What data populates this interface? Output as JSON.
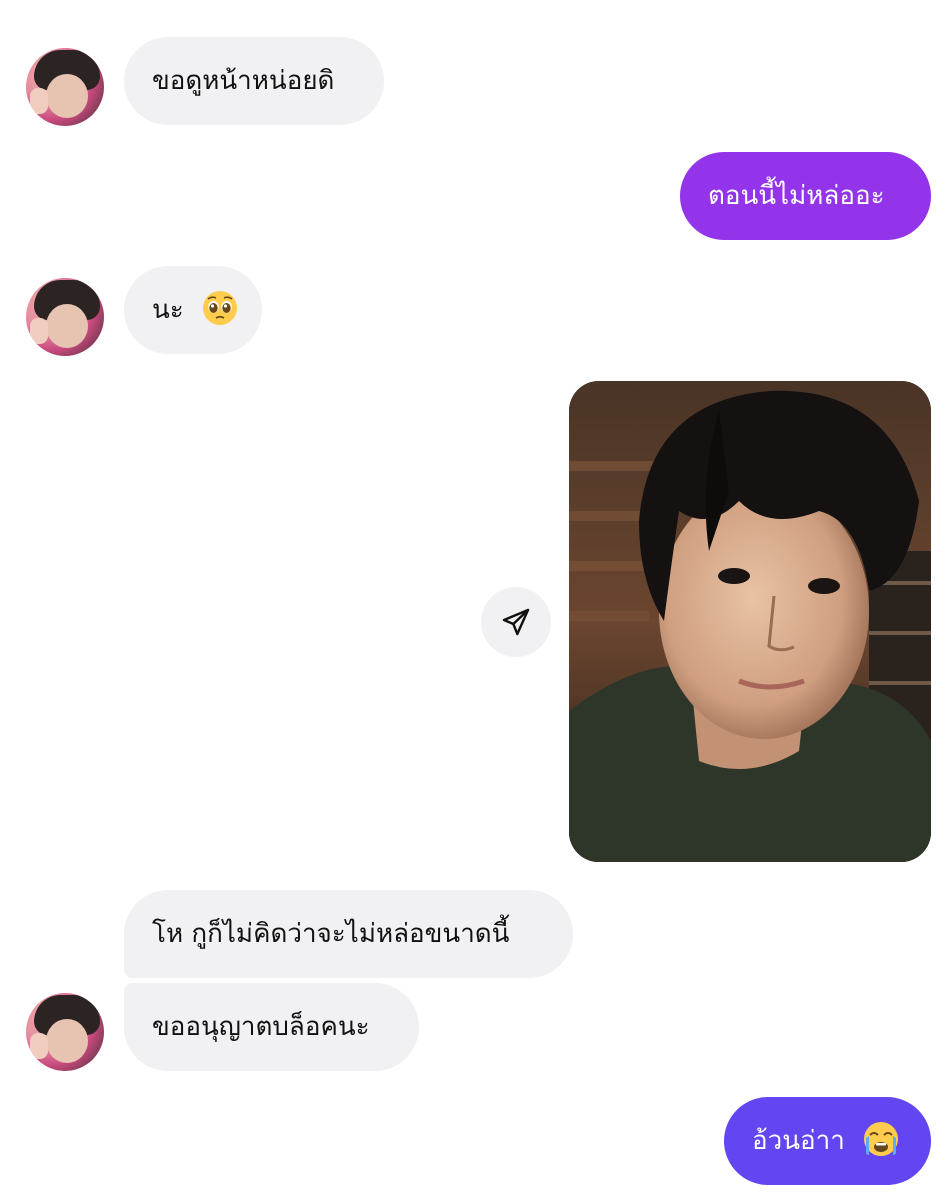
{
  "messages": [
    {
      "id": "m1",
      "direction": "received",
      "text": "ขอดูหน้าหน่อยดิ",
      "show_avatar": true
    },
    {
      "id": "m2",
      "direction": "sent",
      "text": "ตอนนี้ไม่หล่ออะ",
      "color": "#9333ea"
    },
    {
      "id": "m3",
      "direction": "received",
      "text": "นะ",
      "emoji": "pleading-face",
      "show_avatar": true
    },
    {
      "id": "m4",
      "direction": "sent",
      "type": "photo",
      "description": "selfie-photo"
    },
    {
      "id": "m5",
      "direction": "received",
      "text": "โห กูก็ไม่คิดว่าจะไม่หล่อขนาดนี้",
      "show_avatar": false
    },
    {
      "id": "m6",
      "direction": "received",
      "text": "ขออนุญาตบล็อคนะ",
      "show_avatar": true
    },
    {
      "id": "m7",
      "direction": "sent",
      "text": "อ้วนอ่าา",
      "emoji": "loudly-crying-face",
      "color": "#6346f1"
    }
  ],
  "icons": {
    "share": "paper-plane-icon"
  },
  "colors": {
    "received_bubble": "#f1f1f3",
    "sent_purple": "#9333ea",
    "sent_indigo": "#6346f1",
    "background": "#ffffff"
  }
}
